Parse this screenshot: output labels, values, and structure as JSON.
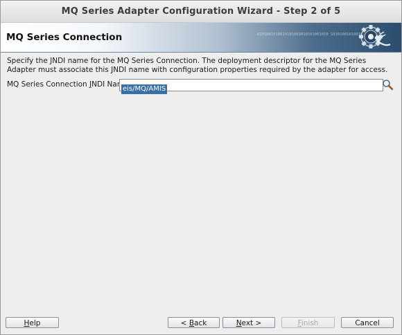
{
  "window": {
    "title": "MQ Series Adapter Configuration Wizard - Step 2 of 5"
  },
  "banner": {
    "title": "MQ Series Connection",
    "icon": "gear-plug-icon",
    "decorative_binary": "0101001010010101001010101001010 101010010100101010100101010100101 0010101001010101001010101001010"
  },
  "content": {
    "description": "Specify the JNDI name for the MQ Series Connection.  The deployment descriptor for the MQ Series Adapter must associate this JNDI name with configuration properties required by the adapter for access.",
    "jndi_label_pre": "MQ Series Connection ",
    "jndi_label_mnemonic": "J",
    "jndi_label_post": "NDI Name",
    "jndi_value": "eis/MQ/AMIS",
    "search_icon": "magnifier-icon"
  },
  "buttons": {
    "help_mnemonic": "H",
    "help_rest": "elp",
    "back_pre": "< ",
    "back_mnemonic": "B",
    "back_rest": "ack",
    "next_mnemonic": "N",
    "next_rest": "ext >",
    "finish_mnemonic": "F",
    "finish_rest": "inish",
    "cancel_label": "Cancel"
  },
  "colors": {
    "selection": "#3a6ea5",
    "banner_dark": "#2c4d6d",
    "background": "#eeeeee"
  }
}
